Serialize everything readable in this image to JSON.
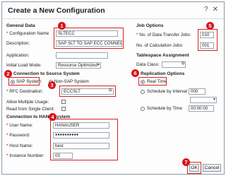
{
  "window": {
    "title": "Create a New Configuration"
  },
  "general": {
    "section": "General Data",
    "config_name_label": "Configuration Name",
    "config_name_value": "SLTECC",
    "description_label": "Description:",
    "description_value": "SAP SLT TO SAP ECC CONNEC",
    "application_label": "Application:",
    "initial_load_label": "Initial Load Mode:",
    "initial_load_value": "Resource Optimized"
  },
  "source": {
    "section": "Connection to Source System",
    "sap_system_label": "SAP System",
    "non_sap_label": "Non-SAP System",
    "rfc_label": "RFC Destination:",
    "rfc_value": "ECCSLT",
    "allow_multiple_label": "Allow Multiple Usage:",
    "read_single_label": "Read from Single Client:"
  },
  "hana": {
    "section": "Connection to HANA System",
    "user_label": "User Name:",
    "user_value": "HANAUSER",
    "password_label": "Password:",
    "password_value": "●●●●●●●●●●",
    "host_label": "Host Name:",
    "host_value": "best",
    "instance_label": "Instance Number:",
    "instance_value": "03"
  },
  "jobs": {
    "section": "Job Options",
    "data_jobs_label": "No. of Data Transfer Jobs:",
    "data_jobs_value": "010",
    "calc_jobs_label": "No. of Calculation Jobs:",
    "calc_jobs_value": "001"
  },
  "tablespace": {
    "section": "Tablespace Assignment",
    "data_class_label": "Data Class:"
  },
  "replication": {
    "section": "Replication Options",
    "real_time_label": "Real Time",
    "interval_label": "Schedule by Interval",
    "interval_value": "000",
    "time_label": "Schedule by Time",
    "time_value": "00:00:00"
  },
  "buttons": {
    "ok": "OK",
    "cancel": "Cancel"
  },
  "badges": [
    "1",
    "2",
    "3",
    "4",
    "5",
    "6",
    "7"
  ],
  "icons": {
    "help": "help-icon",
    "close": "close-icon",
    "copy": "value-help-icon"
  },
  "colors": {
    "annotation": "#d92020",
    "badge": "#d9141b"
  }
}
